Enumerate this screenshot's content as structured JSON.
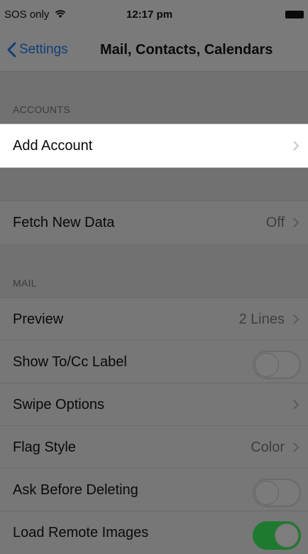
{
  "status_bar": {
    "carrier": "SOS only",
    "time": "12:17 pm"
  },
  "nav": {
    "back_label": "Settings",
    "title": "Mail, Contacts, Calendars"
  },
  "sections": {
    "accounts_header": "ACCOUNTS",
    "mail_header": "MAIL"
  },
  "rows": {
    "add_account": {
      "label": "Add Account"
    },
    "fetch_new_data": {
      "label": "Fetch New Data",
      "value": "Off"
    },
    "preview": {
      "label": "Preview",
      "value": "2 Lines"
    },
    "show_to_cc": {
      "label": "Show To/Cc Label",
      "toggle": "off"
    },
    "swipe_options": {
      "label": "Swipe Options"
    },
    "flag_style": {
      "label": "Flag Style",
      "value": "Color"
    },
    "ask_before_deleting": {
      "label": "Ask Before Deleting",
      "toggle": "off"
    },
    "load_remote_images": {
      "label": "Load Remote Images",
      "toggle": "on"
    }
  },
  "colors": {
    "accent": "#0a7aff",
    "toggle_on": "#4cd964"
  }
}
